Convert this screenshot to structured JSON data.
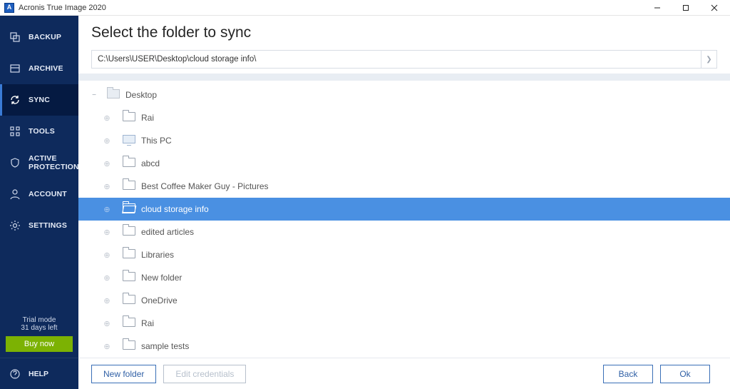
{
  "window_title": "Acronis True Image 2020",
  "sidebar": {
    "items": [
      {
        "label": "BACKUP"
      },
      {
        "label": "ARCHIVE"
      },
      {
        "label": "SYNC"
      },
      {
        "label": "TOOLS"
      },
      {
        "label": "ACTIVE\nPROTECTION"
      },
      {
        "label": "ACCOUNT"
      },
      {
        "label": "SETTINGS"
      }
    ],
    "active_index": 2,
    "trial_line1": "Trial mode",
    "trial_line2": "31 days left",
    "buy_label": "Buy now",
    "help_label": "HELP"
  },
  "main": {
    "page_title": "Select the folder to sync",
    "path_value": "C:\\Users\\USER\\Desktop\\cloud storage info\\",
    "root_label": "Desktop",
    "selected_index": 4,
    "children": [
      {
        "label": "Rai",
        "icon": "folder"
      },
      {
        "label": "This PC",
        "icon": "monitor"
      },
      {
        "label": "abcd",
        "icon": "folder"
      },
      {
        "label": "Best Coffee Maker Guy - Pictures",
        "icon": "folder"
      },
      {
        "label": "cloud storage info",
        "icon": "folder-open"
      },
      {
        "label": "edited articles",
        "icon": "folder"
      },
      {
        "label": "Libraries",
        "icon": "folder"
      },
      {
        "label": "New folder",
        "icon": "folder"
      },
      {
        "label": "OneDrive",
        "icon": "folder"
      },
      {
        "label": "Rai",
        "icon": "folder"
      },
      {
        "label": "sample tests",
        "icon": "folder"
      }
    ]
  },
  "buttons": {
    "new_folder": "New folder",
    "edit_credentials": "Edit credentials",
    "back": "Back",
    "ok": "Ok"
  }
}
